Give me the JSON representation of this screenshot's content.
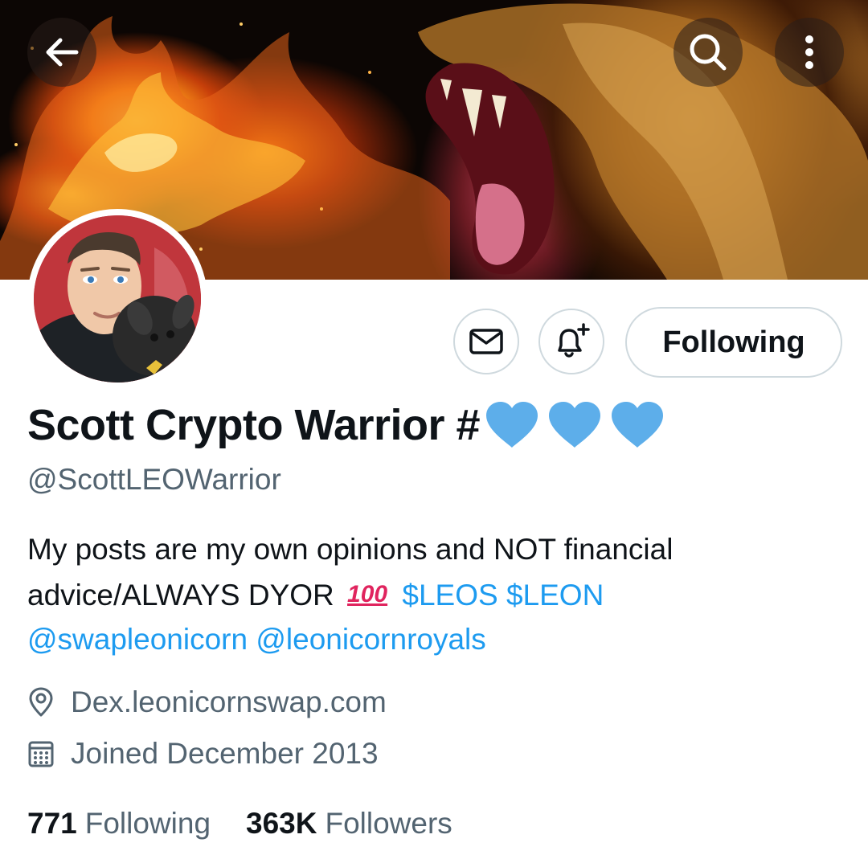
{
  "header": {
    "back_icon": "arrow-left-icon",
    "search_icon": "search-icon",
    "more_icon": "more-vertical-icon"
  },
  "profile": {
    "name": "Scott Crypto Warrior #",
    "name_emojis": [
      "blue-heart",
      "blue-heart",
      "blue-heart"
    ],
    "handle": "@ScottLEOWarrior",
    "bio": {
      "line1": "My posts are my own opinions and NOT financial",
      "line2_text": "advice/ALWAYS DYOR",
      "line2_emoji": "100",
      "cashtag1": "$LEOS",
      "cashtag2": "$LEON",
      "mention1": "@swapleonicorn",
      "mention2": "@leonicornroyals"
    },
    "website": "Dex.leonicornswap.com",
    "joined": "Joined December 2013",
    "following_count": "771",
    "following_label": "Following",
    "followers_count": "363K",
    "followers_label": "Followers"
  },
  "actions": {
    "message_icon": "envelope-icon",
    "notify_icon": "bell-plus-icon",
    "follow_button_label": "Following"
  },
  "colors": {
    "link": "#1d9bf0",
    "secondary_text": "#536471",
    "border": "#cfd9de",
    "heart": "#5daeea"
  }
}
